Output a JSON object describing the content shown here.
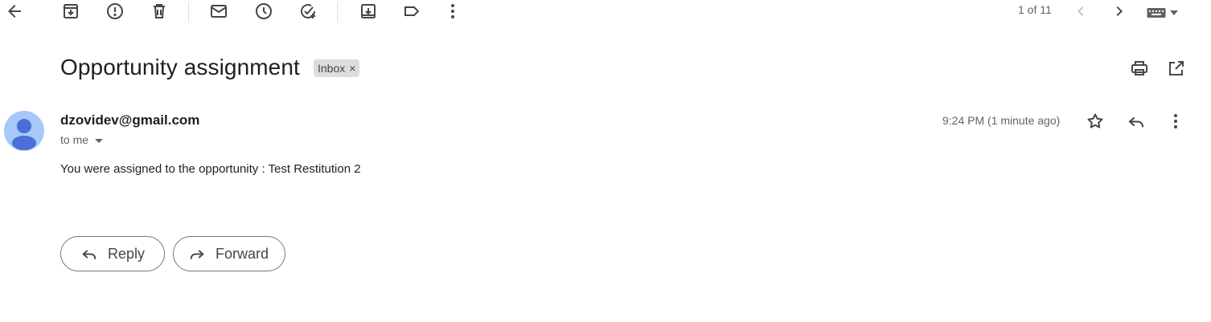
{
  "toolbar": {
    "icons": [
      "back-arrow-icon",
      "archive-icon",
      "report-spam-icon",
      "delete-icon",
      "mark-unread-icon",
      "snooze-icon",
      "add-task-icon",
      "move-to-icon",
      "label-icon",
      "more-vert-icon"
    ]
  },
  "pager": {
    "text": "1 of 11"
  },
  "email": {
    "subject": "Opportunity assignment",
    "label": "Inbox",
    "label_remove": "×",
    "sender": "dzovidev@gmail.com",
    "recipient": "to me",
    "time": "9:24 PM (1 minute ago)",
    "body": "You were assigned to the opportunity : Test Restitution 2"
  },
  "actions": {
    "reply_label": "Reply",
    "forward_label": "Forward"
  },
  "colors": {
    "icon": "#444746",
    "avatar_bg": "#a8c7fa",
    "avatar_fg": "#4a6fd8",
    "chip_bg": "#dddddd"
  }
}
